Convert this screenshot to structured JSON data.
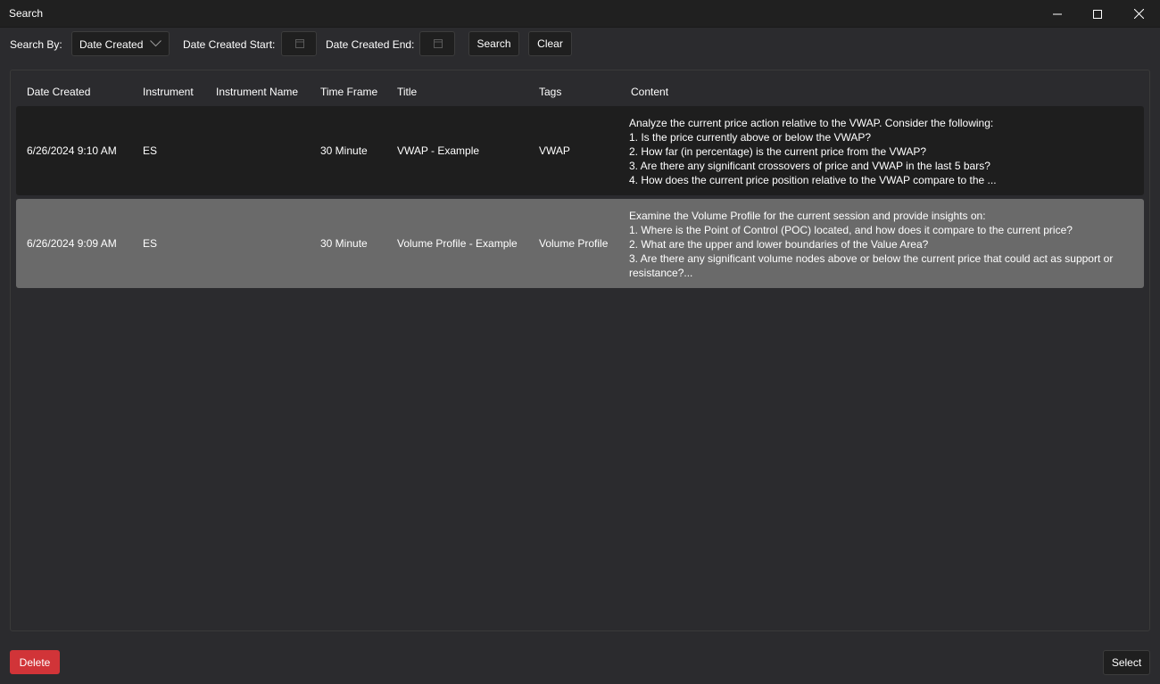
{
  "window": {
    "title": "Search"
  },
  "toolbar": {
    "search_by_label": "Search By:",
    "search_by_value": "Date Created",
    "start_label": "Date Created Start:",
    "end_label": "Date Created End:",
    "search_button": "Search",
    "clear_button": "Clear"
  },
  "grid": {
    "columns": [
      "Date Created",
      "Instrument",
      "Instrument Name",
      "Time Frame",
      "Title",
      "Tags",
      "Content"
    ],
    "rows": [
      {
        "date_created": "6/26/2024 9:10 AM",
        "instrument": "ES",
        "instrument_name": "",
        "time_frame": "30 Minute",
        "title": "VWAP - Example",
        "tags": "VWAP",
        "content": "Analyze the current price action relative to the VWAP. Consider the following:\n1. Is the price currently above or below the VWAP?\n2. How far (in percentage) is the current price from the VWAP?\n3. Are there any significant crossovers of price and VWAP in the last 5 bars?\n4. How does the current price position relative to the VWAP compare to the ..."
      },
      {
        "date_created": "6/26/2024 9:09 AM",
        "instrument": "ES",
        "instrument_name": "",
        "time_frame": "30 Minute",
        "title": "Volume Profile - Example",
        "tags": "Volume Profile",
        "content": "Examine the Volume Profile for the current session and provide insights on:\n1. Where is the Point of Control (POC) located, and how does it compare to the current price?\n2. What are the upper and lower boundaries of the Value Area?\n3. Are there any significant volume nodes above or below the current price that could act as support or resistance?..."
      }
    ]
  },
  "footer": {
    "delete_button": "Delete",
    "select_button": "Select"
  },
  "colors": {
    "delete": "#d13438",
    "selected_row": "#6a6a6a",
    "row": "#1e1e1e",
    "background": "#2b2b2e"
  }
}
